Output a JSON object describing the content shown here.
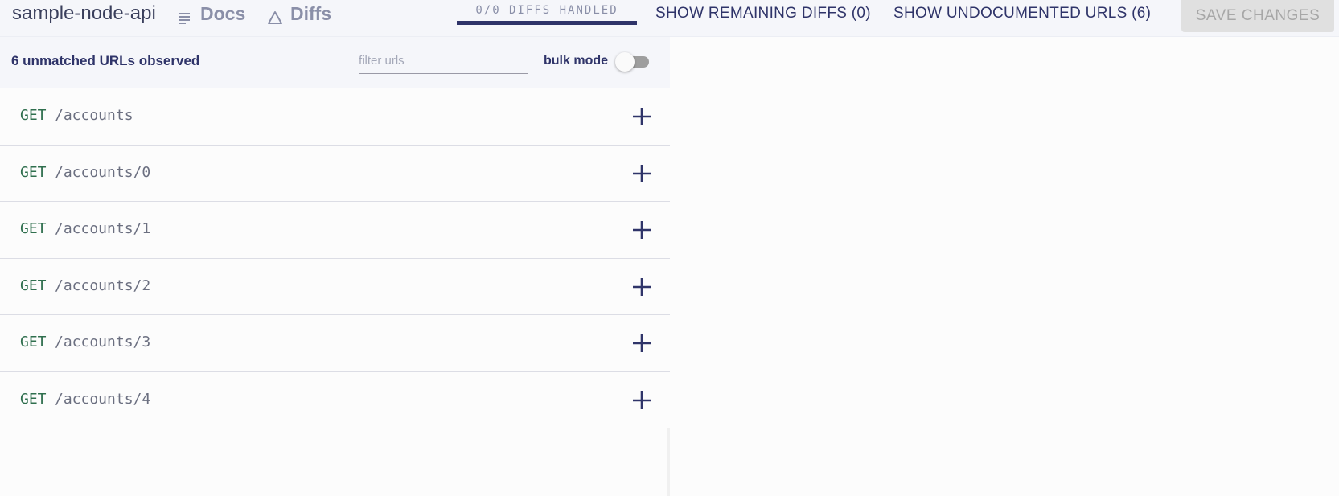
{
  "header": {
    "app_name": "sample-node-api",
    "nav": [
      {
        "label": "Docs",
        "icon": "docs-icon"
      },
      {
        "label": "Diffs",
        "icon": "triangle-icon"
      }
    ],
    "progress_label": "0/0 DIFFS HANDLED",
    "progress_fraction": 1.0,
    "show_remaining_label": "SHOW REMAINING DIFFS (0)",
    "show_undocumented_label": "SHOW UNDOCUMENTED URLS (6)",
    "save_label": "SAVE CHANGES"
  },
  "panel": {
    "title": "6 unmatched URLs observed",
    "filter_placeholder": "filter urls",
    "bulk_mode_label": "bulk mode",
    "bulk_mode_on": false
  },
  "urls": [
    {
      "method": "GET",
      "path": "/accounts"
    },
    {
      "method": "GET",
      "path": "/accounts/0"
    },
    {
      "method": "GET",
      "path": "/accounts/1"
    },
    {
      "method": "GET",
      "path": "/accounts/2"
    },
    {
      "method": "GET",
      "path": "/accounts/3"
    },
    {
      "method": "GET",
      "path": "/accounts/4"
    }
  ],
  "colors": {
    "accent": "#2f3469",
    "method_green": "#2f6f4e",
    "header_bg": "#f5f6fa"
  }
}
